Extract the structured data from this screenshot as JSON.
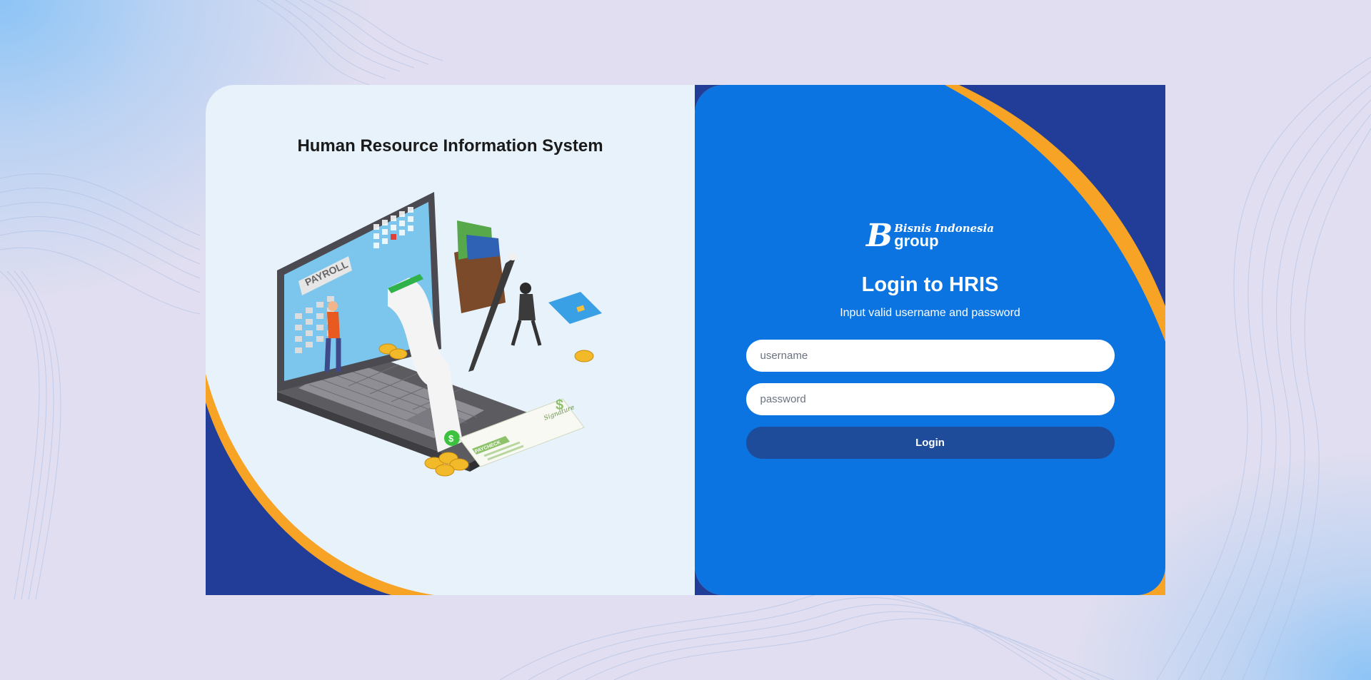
{
  "left": {
    "title": "Human Resource Information System",
    "illustration": {
      "screen_label": "PAYROLL",
      "check_label": "PAYCHECK",
      "signature": "Signature",
      "currency_symbol": "$"
    }
  },
  "right": {
    "logo": {
      "mark": "B",
      "line1": "Bisnis Indonesia",
      "line2": "group"
    },
    "title": "Login to HRIS",
    "subtitle": "Input valid username and password",
    "username_placeholder": "username",
    "password_placeholder": "password",
    "login_label": "Login"
  },
  "colors": {
    "page_background": "#e0def0",
    "left_panel": "#e8f2fb",
    "right_panel": "#0b74e0",
    "navy": "#223d97",
    "orange_accent": "#f7a325",
    "login_button": "#1e4b9a"
  }
}
